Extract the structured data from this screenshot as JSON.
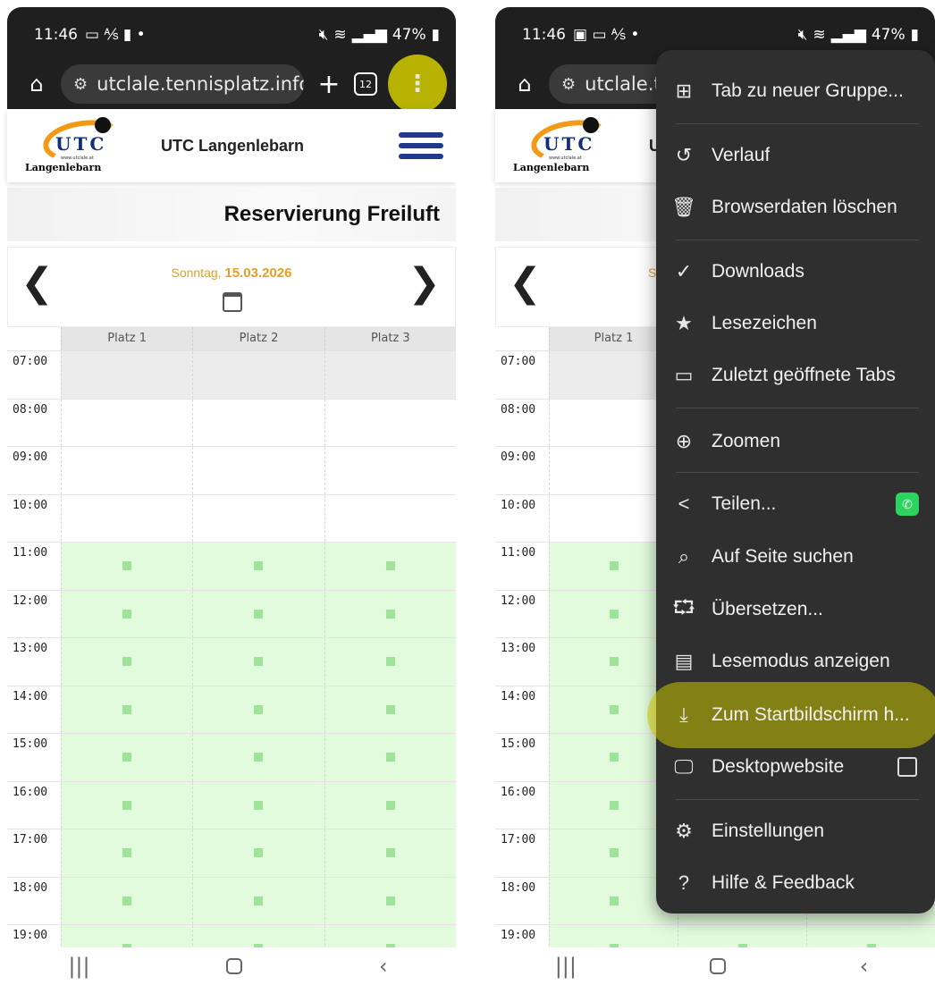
{
  "status_bar": {
    "time": "11:46",
    "battery": "47%"
  },
  "browser": {
    "url": "utclale.tennisplatz.info",
    "url_truncated": "utclale.te",
    "tab_count": "12"
  },
  "site": {
    "brand": "UTC",
    "logo_small": "www.utclale.at",
    "logo_name": "Langenlebarn",
    "title": "UTC Langenlebarn",
    "title_truncated": "UT",
    "heading": "Reservierung Freiluft",
    "date_prefix": "Sonntag, ",
    "date_value": "15.03.2026",
    "date_prefix_truncated": "S"
  },
  "columns": [
    "Platz 1",
    "Platz 2",
    "Platz 3"
  ],
  "times": [
    "07:00",
    "08:00",
    "09:00",
    "10:00",
    "11:00",
    "12:00",
    "13:00",
    "14:00",
    "15:00",
    "16:00",
    "17:00",
    "18:00",
    "19:00"
  ],
  "menu": {
    "items": [
      {
        "label": "Tab zu neuer Gruppe...",
        "icon": "tab-group-icon"
      },
      {
        "label": "Verlauf",
        "icon": "history-icon"
      },
      {
        "label": "Browserdaten löschen",
        "icon": "trash-icon"
      },
      {
        "label": "Downloads",
        "icon": "download-icon"
      },
      {
        "label": "Lesezeichen",
        "icon": "star-icon"
      },
      {
        "label": "Zuletzt geöffnete Tabs",
        "icon": "devices-icon"
      },
      {
        "label": "Zoomen",
        "icon": "zoom-icon"
      },
      {
        "label": "Teilen...",
        "icon": "share-icon"
      },
      {
        "label": "Auf Seite suchen",
        "icon": "find-icon"
      },
      {
        "label": "Übersetzen...",
        "icon": "translate-icon"
      },
      {
        "label": "Lesemodus anzeigen",
        "icon": "reader-icon"
      },
      {
        "label": "Zum Startbildschirm h...",
        "icon": "add-to-home-icon"
      },
      {
        "label": "Desktopwebsite",
        "icon": "desktop-icon"
      },
      {
        "label": "Einstellungen",
        "icon": "gear-icon"
      },
      {
        "label": "Hilfe & Feedback",
        "icon": "help-icon"
      }
    ]
  },
  "colors": {
    "accent_highlight": "#c9c400",
    "free_slot": "#e2fbdc",
    "date_orange": "#e6a020",
    "brand_blue": "#1f3a8a"
  }
}
